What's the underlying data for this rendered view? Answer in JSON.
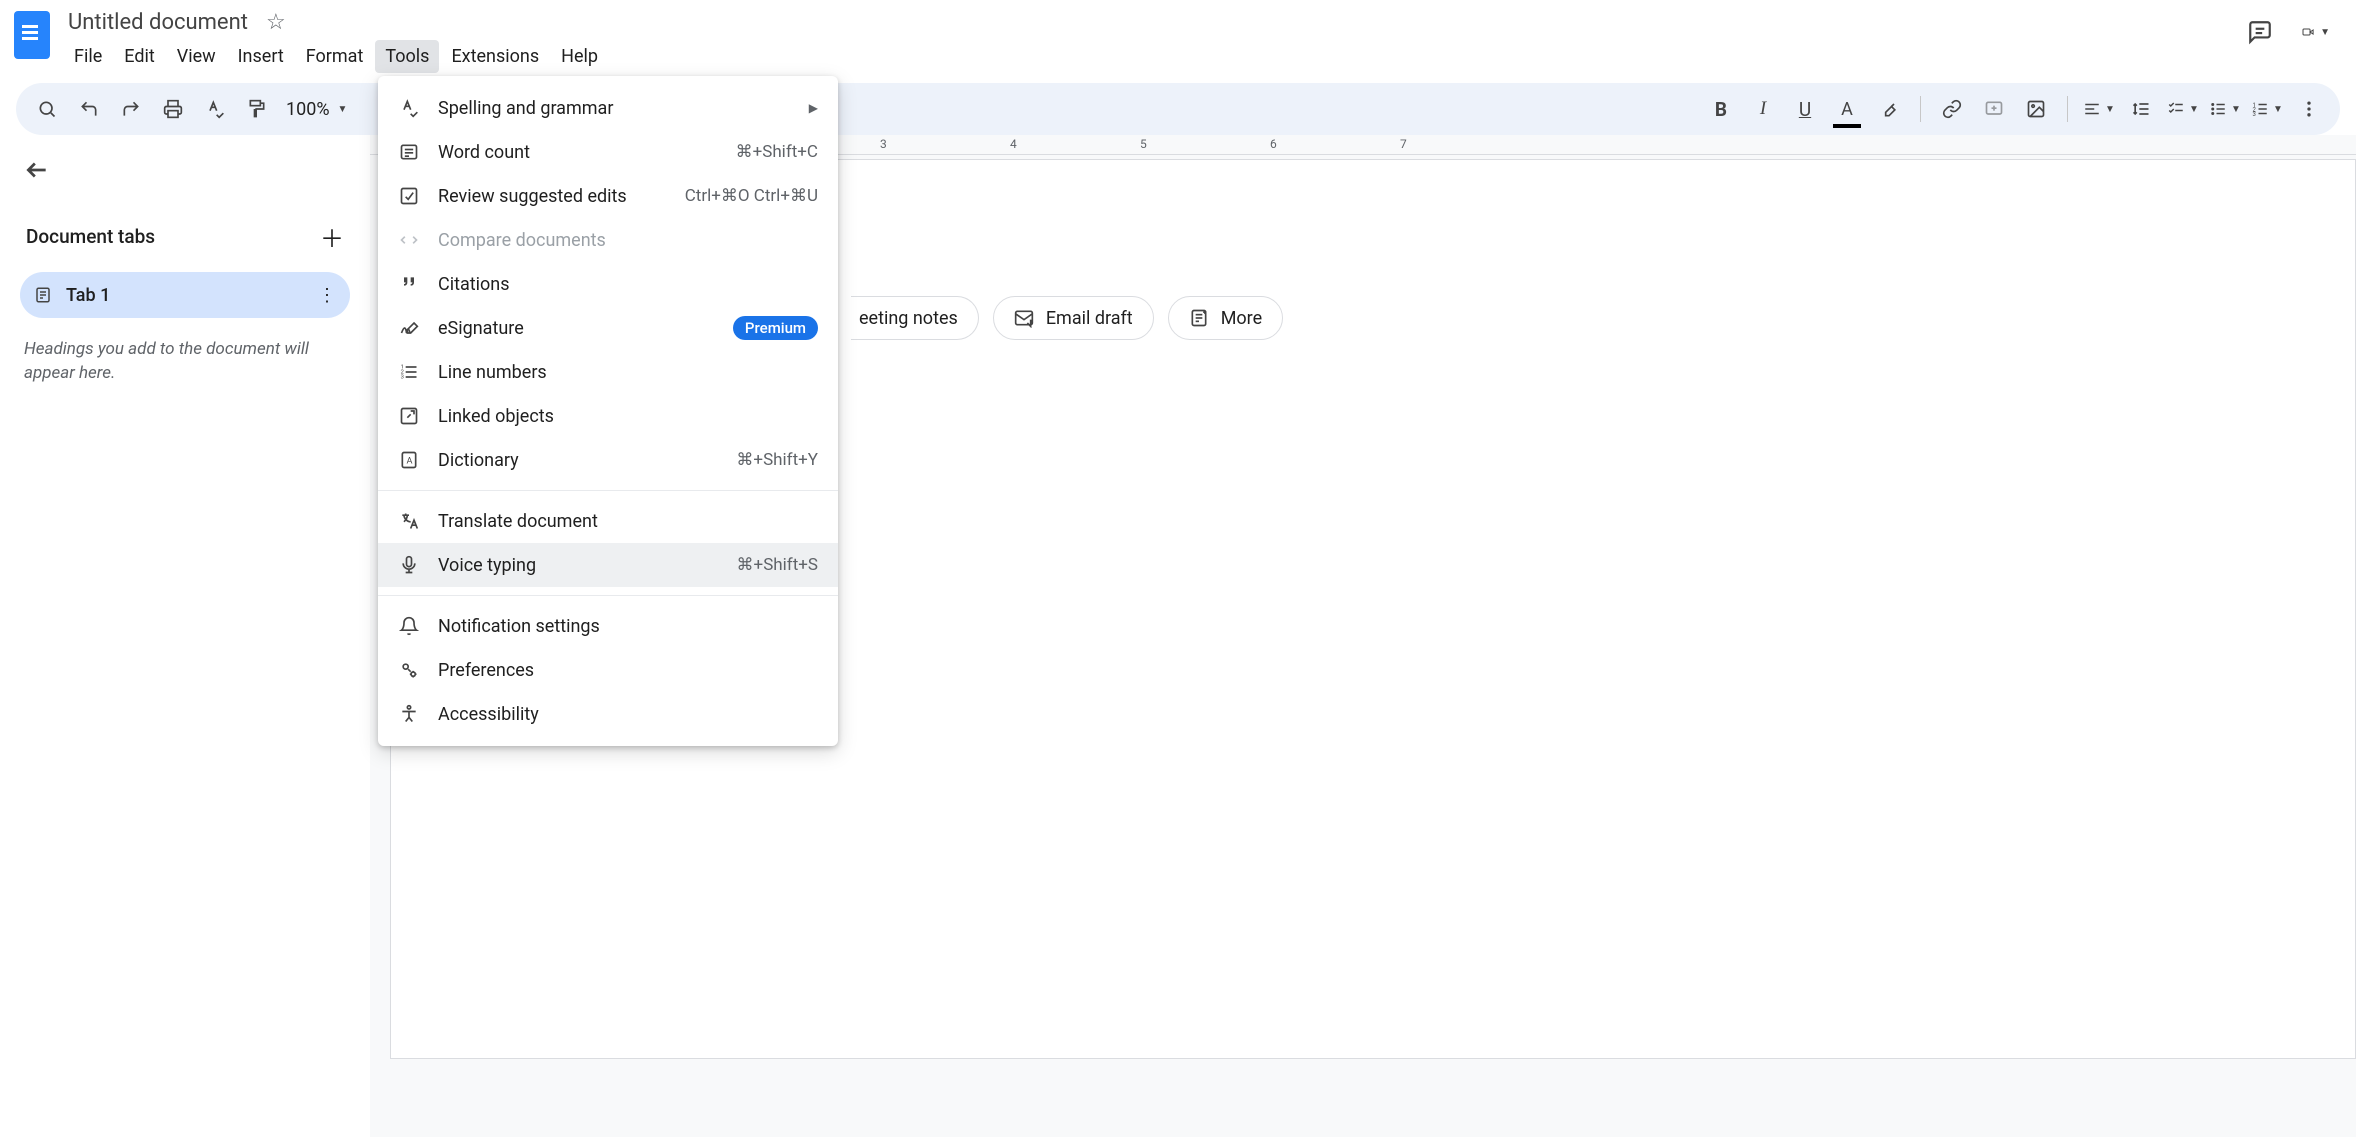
{
  "header": {
    "doc_title": "Untitled document",
    "menus": [
      "File",
      "Edit",
      "View",
      "Insert",
      "Format",
      "Tools",
      "Extensions",
      "Help"
    ],
    "open_menu_index": 5
  },
  "toolbar": {
    "zoom": "100%"
  },
  "sidebar": {
    "tabs_title": "Document tabs",
    "tab_label": "Tab 1",
    "hint": "Headings you add to the document will appear here."
  },
  "ruler": {
    "marks": [
      {
        "num": "3",
        "pos": 510
      },
      {
        "num": "4",
        "pos": 640
      },
      {
        "num": "5",
        "pos": 770
      },
      {
        "num": "6",
        "pos": 900
      },
      {
        "num": "7",
        "pos": 1030
      }
    ]
  },
  "chips": {
    "partial": "eeting notes",
    "email": "Email draft",
    "more": "More"
  },
  "tools_menu": {
    "items": [
      {
        "icon": "spellcheck",
        "label": "Spelling and grammar",
        "submenu": true
      },
      {
        "icon": "wordcount",
        "label": "Word count",
        "shortcut": "⌘+Shift+C"
      },
      {
        "icon": "review",
        "label": "Review suggested edits",
        "shortcut": "Ctrl+⌘O Ctrl+⌘U"
      },
      {
        "icon": "compare",
        "label": "Compare documents",
        "disabled": true
      },
      {
        "icon": "citations",
        "label": "Citations"
      },
      {
        "icon": "esign",
        "label": "eSignature",
        "badge": "Premium"
      },
      {
        "icon": "linenum",
        "label": "Line numbers"
      },
      {
        "icon": "linked",
        "label": "Linked objects"
      },
      {
        "icon": "dictionary",
        "label": "Dictionary",
        "shortcut": "⌘+Shift+Y"
      },
      {
        "sep": true
      },
      {
        "icon": "translate",
        "label": "Translate document"
      },
      {
        "icon": "voice",
        "label": "Voice typing",
        "shortcut": "⌘+Shift+S",
        "hovered": true
      },
      {
        "sep": true
      },
      {
        "icon": "bell",
        "label": "Notification settings"
      },
      {
        "icon": "prefs",
        "label": "Preferences"
      },
      {
        "icon": "a11y",
        "label": "Accessibility"
      }
    ]
  }
}
